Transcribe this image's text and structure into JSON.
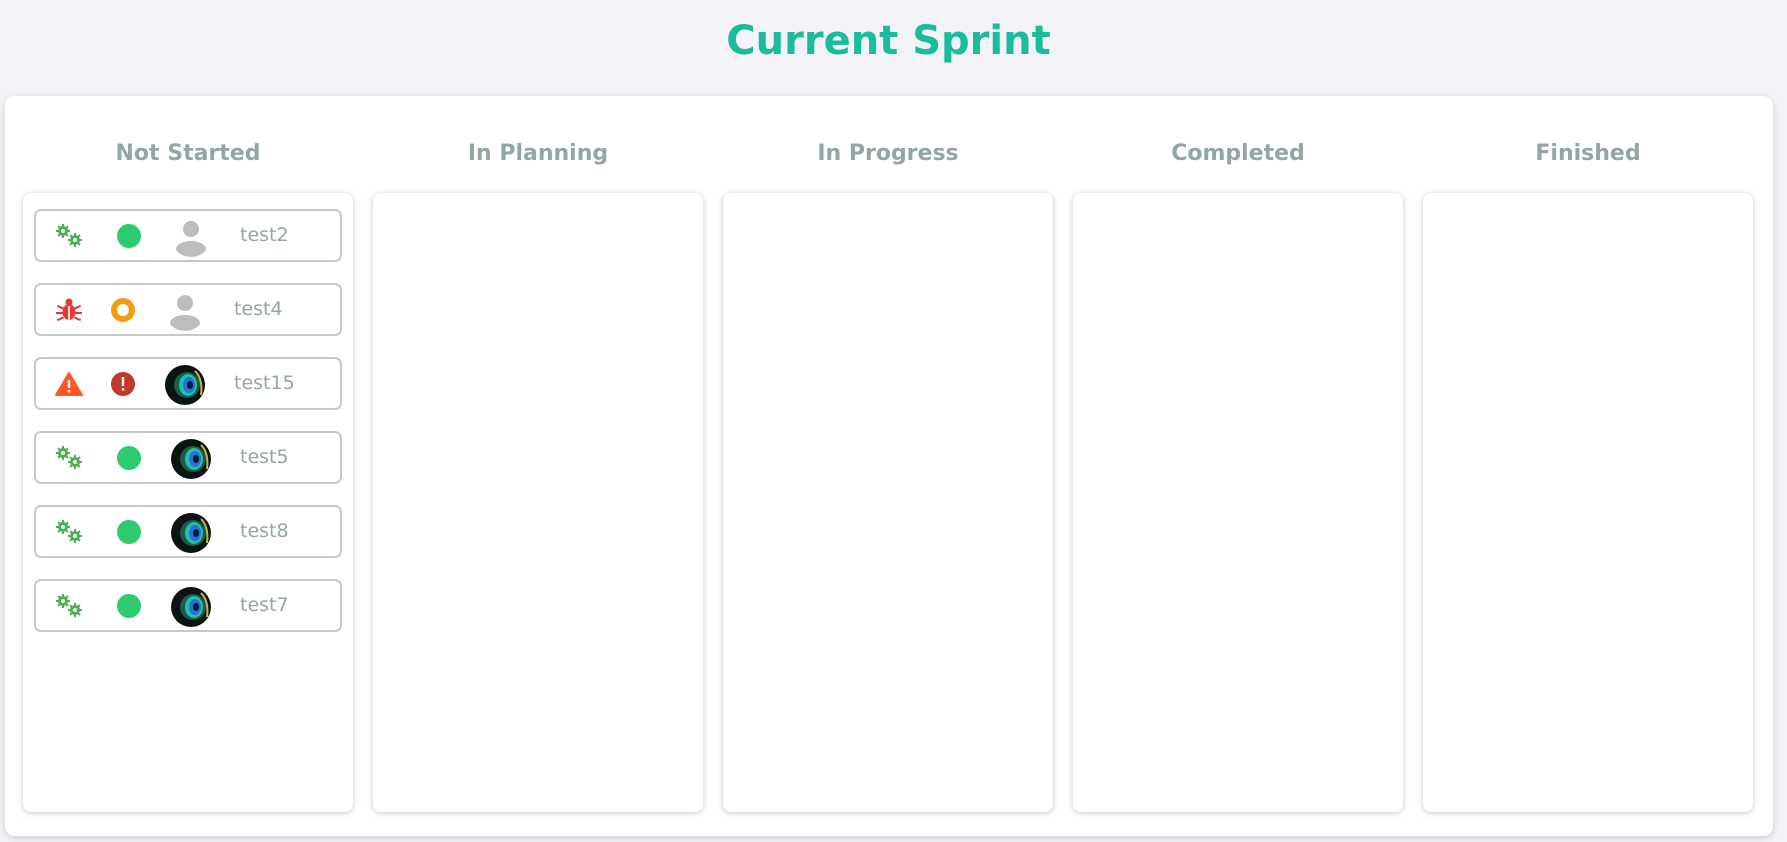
{
  "page": {
    "title": "Current Sprint"
  },
  "columns": [
    {
      "title": "Not Started",
      "tasks": [
        {
          "name": "test2",
          "type": "gears-icon",
          "status": "green-dot-icon",
          "assignee": "default-user-avatar"
        },
        {
          "name": "test4",
          "type": "bug-icon",
          "status": "orange-ring-icon",
          "assignee": "default-user-avatar"
        },
        {
          "name": "test15",
          "type": "warning-triangle-icon",
          "status": "red-exclamation-icon",
          "assignee": "peacock-photo-avatar"
        },
        {
          "name": "test5",
          "type": "gears-icon",
          "status": "green-dot-icon",
          "assignee": "peacock-photo-avatar"
        },
        {
          "name": "test8",
          "type": "gears-icon",
          "status": "green-dot-icon",
          "assignee": "peacock-photo-avatar"
        },
        {
          "name": "test7",
          "type": "gears-icon",
          "status": "green-dot-icon",
          "assignee": "peacock-photo-avatar"
        }
      ]
    },
    {
      "title": "In Planning",
      "tasks": []
    },
    {
      "title": "In Progress",
      "tasks": []
    },
    {
      "title": "Completed",
      "tasks": []
    },
    {
      "title": "Finished",
      "tasks": []
    }
  ],
  "colors": {
    "title": "#1abc9c",
    "column_title": "#95a5a6",
    "task_name": "#95a5a6",
    "gears": "#4caf50",
    "green_dot": "#2ecc71",
    "orange_ring": "#f39c12",
    "bug": "#e53935",
    "warning": "#ff5722",
    "red_exclamation": "#c0392b",
    "default_avatar": "#bdbdbd",
    "card_border": "#c8c8c8"
  }
}
